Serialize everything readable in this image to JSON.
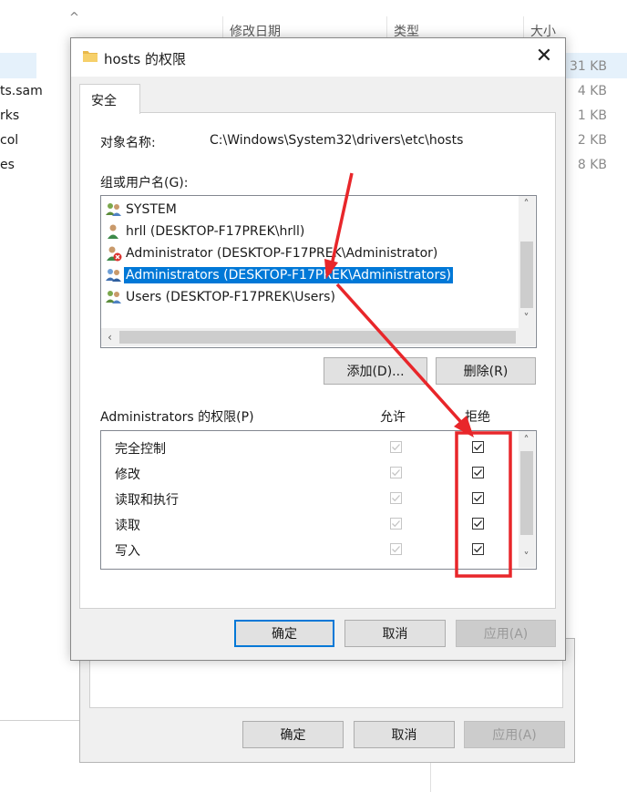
{
  "explorer": {
    "columns": {
      "name_sort": "^",
      "date": "修改日期",
      "type": "类型",
      "size": "大小"
    },
    "files": [
      "ts.sam",
      "rks",
      "col",
      "es"
    ],
    "sizes": [
      "31 KB",
      "4 KB",
      "1 KB",
      "2 KB",
      "8 KB"
    ]
  },
  "dialog": {
    "title": "hosts 的权限",
    "close_glyph": "✕",
    "tab": "安全",
    "object_label": "对象名称:",
    "object_path": "C:\\Windows\\System32\\drivers\\etc\\hosts",
    "group_label": "组或用户名(G):",
    "users": [
      {
        "name": "SYSTEM",
        "icon": "group-users-icon"
      },
      {
        "name": "hrll (DESKTOP-F17PREK\\hrll)",
        "icon": "single-user-icon"
      },
      {
        "name": "Administrator (DESKTOP-F17PREK\\Administrator)",
        "icon": "disabled-user-icon"
      },
      {
        "name": "Administrators (DESKTOP-F17PREK\\Administrators)",
        "icon": "group-users-icon",
        "selected": true
      },
      {
        "name": "Users (DESKTOP-F17PREK\\Users)",
        "icon": "group-users-icon"
      }
    ],
    "add_button": "添加(D)...",
    "remove_button": "删除(R)",
    "perm_header": "Administrators 的权限(P)",
    "allow_header": "允许",
    "deny_header": "拒绝",
    "permissions": [
      {
        "name": "完全控制",
        "allow": true,
        "deny": true
      },
      {
        "name": "修改",
        "allow": true,
        "deny": true
      },
      {
        "name": "读取和执行",
        "allow": true,
        "deny": true
      },
      {
        "name": "读取",
        "allow": true,
        "deny": true
      },
      {
        "name": "写入",
        "allow": true,
        "deny": true
      }
    ],
    "ok_button": "确定",
    "cancel_button": "取消",
    "apply_button": "应用(A)"
  },
  "back_dialog": {
    "ok_button": "确定",
    "cancel_button": "取消",
    "apply_button": "应用(A)"
  },
  "colors": {
    "selection": "#0078d7",
    "annotation": "#e8262a",
    "dialog_bg": "#f0f0f0"
  }
}
